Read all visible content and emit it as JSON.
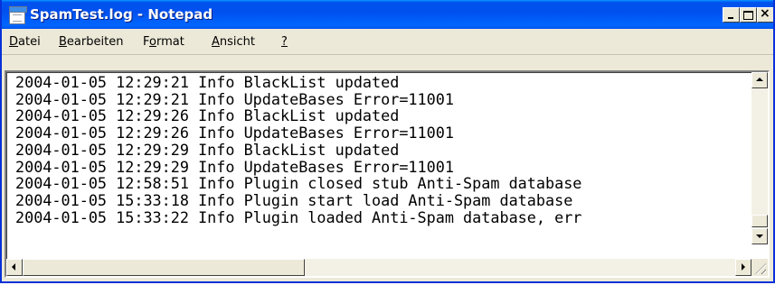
{
  "window": {
    "title": "SpamTest.log - Notepad",
    "app_icon": "notepad-icon",
    "frame_color": "#0831d9",
    "titlebar_color": "#0058ee"
  },
  "caption_buttons": {
    "minimize": "_",
    "maximize": "□",
    "close": "×"
  },
  "menu": {
    "items": [
      {
        "hotkey": "D",
        "rest": "atei"
      },
      {
        "hotkey": "B",
        "rest": "earbeiten"
      },
      {
        "pre": "F",
        "hotkey": "o",
        "rest": "rmat"
      },
      {
        "hotkey": "A",
        "rest": "nsicht"
      },
      {
        "hotkey": "?",
        "rest": ""
      }
    ]
  },
  "editor": {
    "lines": [
      "2004-01-05 12:29:21 Info BlackList updated",
      "2004-01-05 12:29:21 Info UpdateBases Error=11001",
      "2004-01-05 12:29:26 Info BlackList updated",
      "2004-01-05 12:29:26 Info UpdateBases Error=11001",
      "2004-01-05 12:29:29 Info BlackList updated",
      "2004-01-05 12:29:29 Info UpdateBases Error=11001",
      "2004-01-05 12:58:51 Info Plugin closed stub Anti-Spam database",
      "2004-01-05 15:33:18 Info Plugin start load Anti-Spam database",
      "2004-01-05 15:33:22 Info Plugin loaded Anti-Spam database, err"
    ]
  }
}
